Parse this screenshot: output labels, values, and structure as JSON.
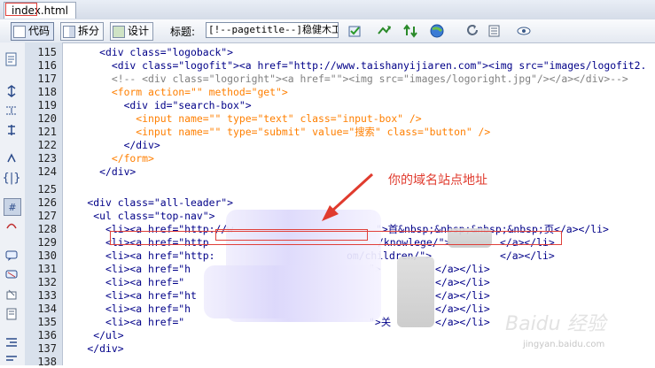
{
  "tab": {
    "file_name": "index.html"
  },
  "toolbar": {
    "code_label": "代码",
    "split_label": "拆分",
    "design_label": "设计",
    "title_label": "标题:",
    "title_value": "[!--pagetitle--]稳健木工-"
  },
  "gutter": {
    "lines": [
      "115",
      "116",
      "117",
      "118",
      "119",
      "120",
      "121",
      "122",
      "123",
      "124",
      "125",
      "126",
      "127",
      "128",
      "129",
      "130",
      "131",
      "132",
      "133",
      "134",
      "135",
      "136",
      "137",
      "138"
    ]
  },
  "code": {
    "l115": "      <div class=\"logoback\">",
    "l116a": "        <div class=\"logofit\"><a href=\"http://www.taishanyijiaren.com\">",
    "l116b": "<img src=\"images/logofit2.",
    "l117": "        <!-- <div class=\"logoright\"><a href=\"\"><img src=\"images/logoright.jpg\"/></a></div>-->",
    "l118": "        <form action=\"\" method=\"get\">",
    "l119": "          <div id=\"search-box\">",
    "l120": "            <input name=\"\" type=\"text\" class=\"input-box\" />",
    "l121": "            <input name=\"\" type=\"submit\" value=\"搜索\" class=\"button\" />",
    "l122": "          </div>",
    "l123": "        </form>",
    "l124": "      </div>",
    "l125": "",
    "l126": "    <div class=\"all-leader\">",
    "l127": "     <ul class=\"top-nav\">",
    "l128a": "       <li><a href=\"http://w",
    "l128b": "\">首&nbsp;&nbsp;&nbsp;&nbsp;页</a></li>",
    "l129a": "       <li><a href=\"http",
    "l129b": "/knowlege/\">",
    "l129c": "</a></li>",
    "l130a": "       <li><a href=\"http:",
    "l130b": "om/children/\">",
    "l130c": "</a></li>",
    "l131": "       <li><a href=\"h",
    "l131b": "\">",
    "l131c": "</a></li>",
    "l132": "       <li><a href=\"",
    "l132b": "</a></li>",
    "l133": "       <li><a href=\"ht",
    "l133b": "</a></li>",
    "l134": "       <li><a href=\"h",
    "l134b": "</a></li>",
    "l135": "       <li><a href=\"",
    "l135b": "\">关",
    "l135c": "</a></li>",
    "l136": "     </ul>",
    "l137": "    </div>",
    "l138": ""
  },
  "annotation": {
    "text": "你的域名站点地址"
  },
  "watermark": {
    "text": "Baidu 经验",
    "url": "jingyan.baidu.com"
  },
  "colors": {
    "annotation": "#e03b2e",
    "tag": "#000088",
    "string": "#0000ff",
    "comment": "#808080",
    "form": "#ff7f00"
  }
}
